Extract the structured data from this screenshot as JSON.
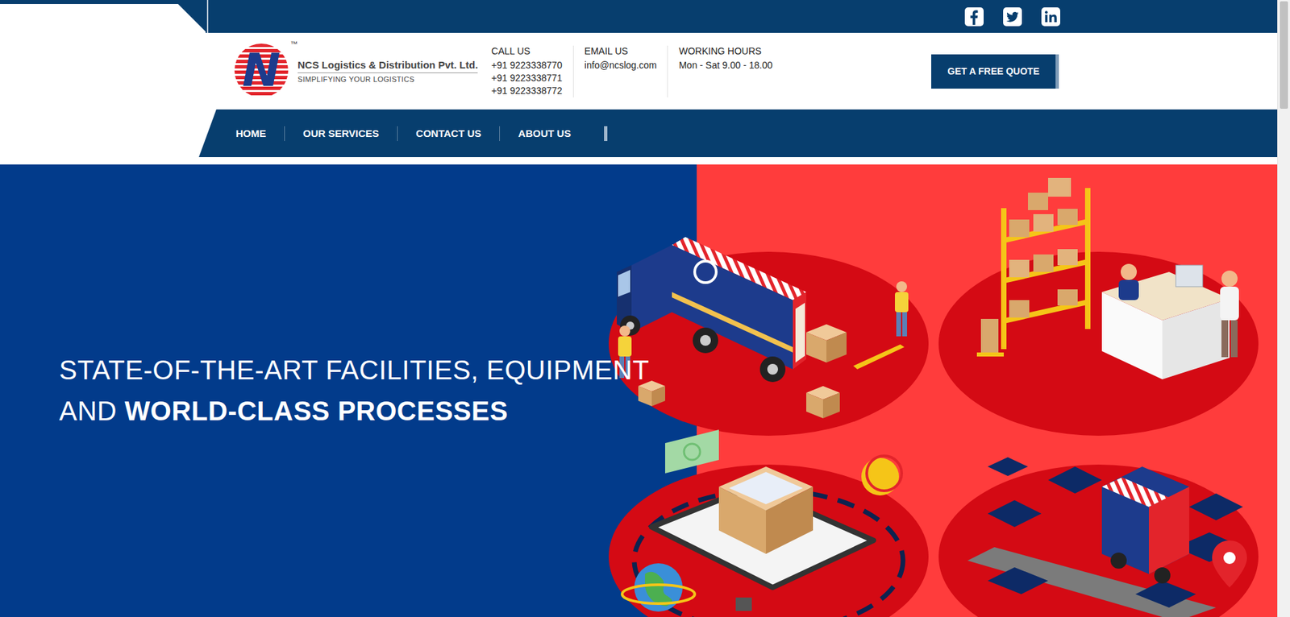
{
  "logo": {
    "mark": "N",
    "tm": "™",
    "company": "NCS Logistics & Distribution Pvt. Ltd.",
    "tagline": "SIMPLIFYING YOUR LOGISTICS"
  },
  "contact": [
    {
      "label": "CALL US",
      "lines": [
        "+91 9223338770",
        "+91 9223338771",
        "+91 9223338772"
      ]
    },
    {
      "label": "EMAIL US",
      "lines": [
        "info@ncslog.com"
      ]
    },
    {
      "label": "WORKING HOURS",
      "lines": [
        "Mon - Sat 9.00 - 18.00"
      ]
    }
  ],
  "quote_button": "GET A FREE QUOTE",
  "nav": [
    "HOME",
    "OUR SERVICES",
    "CONTACT US",
    "ABOUT US"
  ],
  "hero": {
    "line1": "STATE-OF-THE-ART FACILITIES, EQUIPMENT",
    "line2_lead": "AND ",
    "line2_bold": "WORLD-CLASS PROCESSES"
  }
}
